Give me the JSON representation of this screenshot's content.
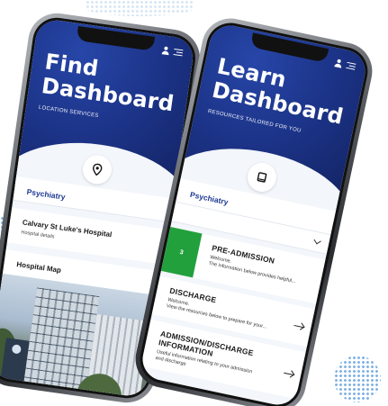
{
  "find_phone": {
    "title_line1": "Find",
    "title_line2": "Dashboard",
    "subtitle": "LOCATION SERVICES",
    "section": "Psychiatry",
    "hospital_card": {
      "title": "Calvary St Luke's Hospital",
      "detail": "Hospital details"
    },
    "map_card": {
      "title": "Hospital Map"
    },
    "icons": {
      "badge": "location-pin-icon",
      "user": "user-icon",
      "menu": "menu-icon"
    }
  },
  "learn_phone": {
    "title_line1": "Learn",
    "title_line2": "Dashboard",
    "subtitle": "RESOURCES TAILORED FOR YOU",
    "section": "Psychiatry",
    "items": [
      {
        "tag": "3",
        "title": "PRE-ADMISSION",
        "line1": "Welcome.",
        "line2": "The information below provides helpful..."
      },
      {
        "title": "DISCHARGE",
        "line1": "Welcome.",
        "line2": "View the resources below to prepare for your..."
      },
      {
        "title": "ADMISSION/DISCHARGE INFORMATION",
        "line1": "Useful information relating to your admission",
        "line2": "and discharge"
      }
    ],
    "icons": {
      "badge": "book-icon",
      "user": "user-icon",
      "menu": "menu-icon"
    }
  },
  "colors": {
    "brand_blue": "#1b3285",
    "accent_green": "#21a03c",
    "section_text": "#1f3a93"
  }
}
